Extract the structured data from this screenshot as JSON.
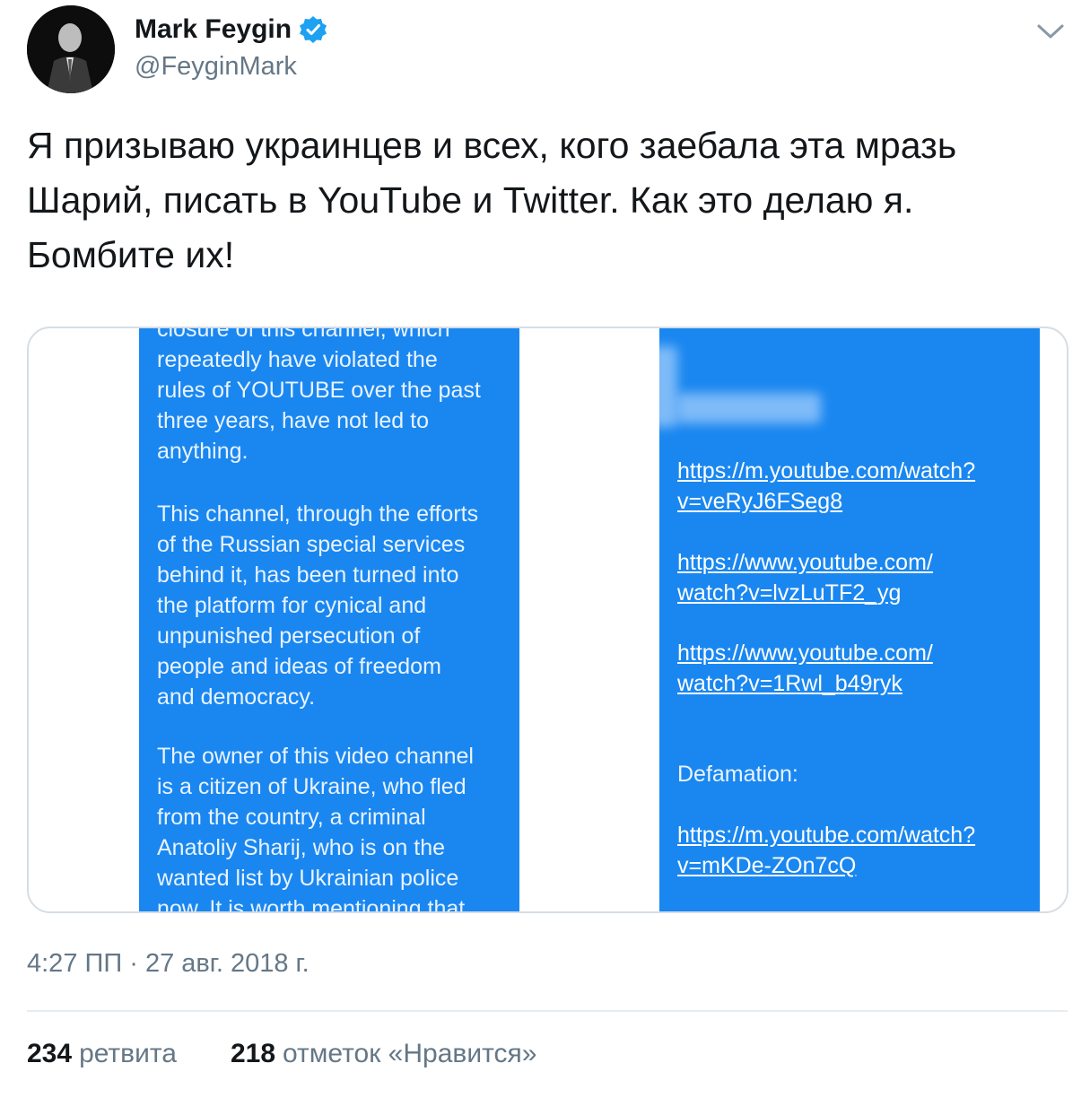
{
  "author": {
    "name": "Mark Feygin",
    "handle": "@FeyginMark"
  },
  "icons": {
    "verified": "verified-badge-icon",
    "menu": "chevron-down-icon"
  },
  "colors": {
    "verified_blue": "#1da1f2",
    "panel_blue": "#1a87f0",
    "secondary_text": "#657786"
  },
  "tweet": {
    "text": "Я призываю украинцев и всех, кого заебала эта мразь\nШарий, писать в YouTube и Twitter. Как это делаю я.\nБомбите их!"
  },
  "media": {
    "left_panel": {
      "para1": "closure of this channel, which\nrepeatedly have violated the\nrules of YOUTUBE over the past\nthree years, have not led to\nanything.",
      "para2": "This channel, through the efforts\nof the Russian special services\nbehind it, has been turned into\nthe platform for cynical and\nunpunished persecution of\npeople and ideas of freedom\nand democracy.",
      "para3": "The owner of this video channel\nis a citizen of Ukraine, who fled\nfrom the country, a criminal\nAnatoliy Sharij, who is on the\nwanted list by Ukrainian police\nnow. It is worth mentioning that"
    },
    "right_panel": {
      "link1": "https://m.youtube.com/watch?\nv=veRyJ6FSeg8",
      "link2": "https://www.youtube.com/\nwatch?v=lvzLuTF2_yg",
      "link3": "https://www.youtube.com/\nwatch?v=1Rwl_b49ryk",
      "defamation_label": "Defamation:",
      "link4": "https://m.youtube.com/watch?\nv=mKDe-ZOn7cQ"
    }
  },
  "timestamp": "4:27 ПП · 27 авг. 2018 г.",
  "stats": {
    "retweets_count": "234",
    "retweets_label": "ретвита",
    "likes_count": "218",
    "likes_label": "отметок «Нравится»"
  }
}
